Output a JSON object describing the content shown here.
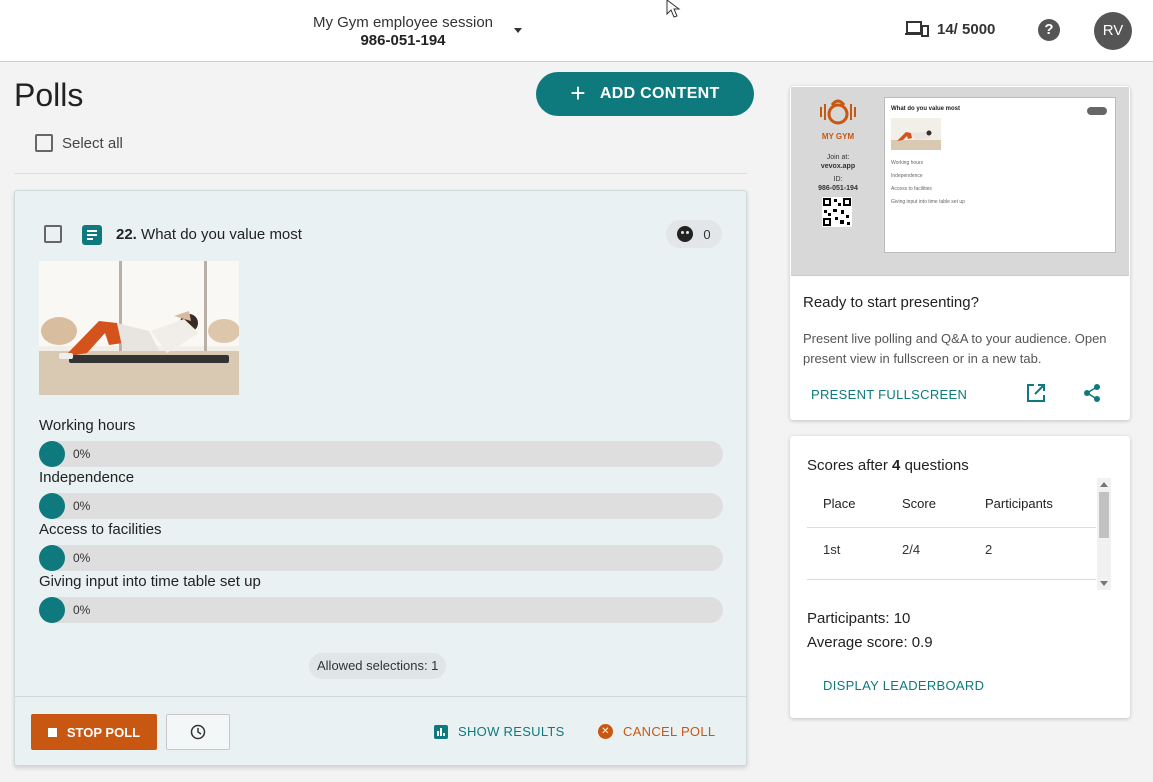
{
  "header": {
    "session_name": "My Gym employee session",
    "session_id": "986-051-194",
    "devices_count": "14/ 5000",
    "help_label": "?",
    "avatar_initials": "RV"
  },
  "page": {
    "title": "Polls",
    "add_content_label": "ADD CONTENT",
    "select_all_label": "Select all"
  },
  "poll": {
    "number": "22.",
    "title": "What do you value most",
    "participants": "0",
    "options": [
      {
        "label": "Working hours",
        "percent_text": "0%",
        "percent": 0
      },
      {
        "label": "Independence",
        "percent_text": "0%",
        "percent": 0
      },
      {
        "label": "Access to facilities",
        "percent_text": "0%",
        "percent": 0
      },
      {
        "label": "Giving input into time table set up",
        "percent_text": "0%",
        "percent": 0
      }
    ],
    "allowed_selections": "Allowed selections: 1",
    "stop_label": "STOP POLL",
    "show_results_label": "SHOW RESULTS",
    "cancel_label": "CANCEL POLL"
  },
  "present": {
    "preview": {
      "logo_text": "MY GYM",
      "join_at_label": "Join at:",
      "join_url": "vevox.app",
      "id_label": "ID:",
      "id_value": "986-051-194",
      "slide_title": "What do you value most",
      "options": [
        "Working hours",
        "Independence",
        "Access to facilities",
        "Giving input into time table set up"
      ]
    },
    "title": "Ready to start presenting?",
    "description": "Present live polling and Q&A to your audience. Open present view in fullscreen or in a new tab.",
    "fullscreen_label": "PRESENT FULLSCREEN"
  },
  "scores": {
    "title_prefix": "Scores after",
    "count": "4",
    "title_suffix": "questions",
    "columns": [
      "Place",
      "Score",
      "Participants"
    ],
    "rows": [
      {
        "place": "1st",
        "score": "2/4",
        "participants": "2"
      }
    ],
    "participants_text": "Participants: 10",
    "average_text": "Average score: 0.9",
    "leaderboard_label": "DISPLAY LEADERBOARD"
  },
  "colors": {
    "primary": "#0e7a7d",
    "danger": "#c85712"
  }
}
